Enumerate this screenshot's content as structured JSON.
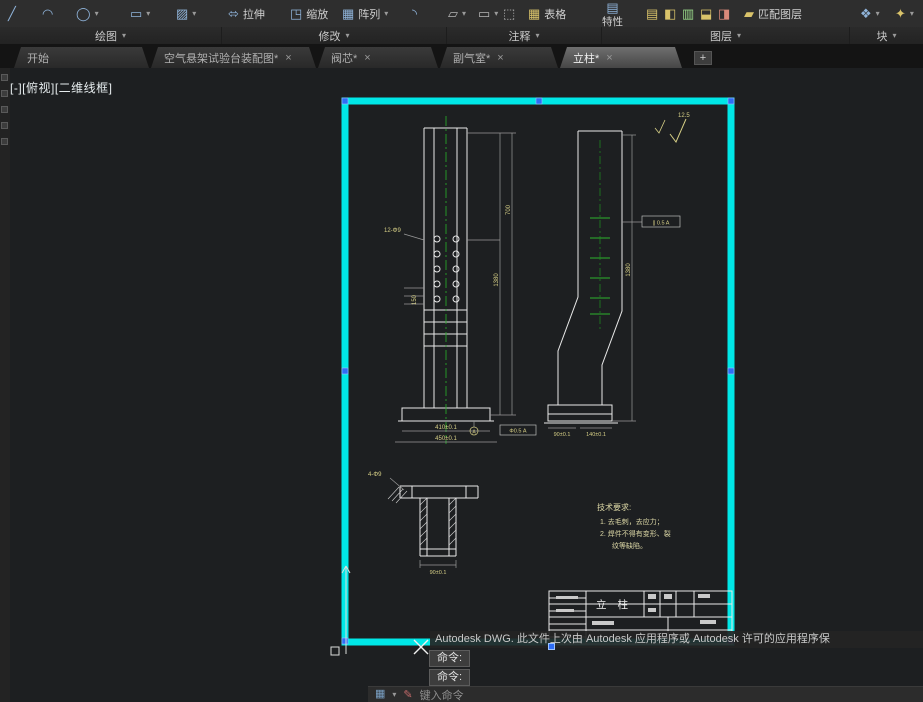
{
  "ribbon": {
    "row1": {
      "stretch": "拉伸",
      "scale": "缩放",
      "array": "阵列",
      "table": "表格",
      "properties": "特性",
      "match_layer": "匹配图层"
    },
    "panels": [
      {
        "label": "绘图"
      },
      {
        "label": "修改"
      },
      {
        "label": "注释"
      },
      {
        "label": "图层"
      },
      {
        "label": "块"
      }
    ]
  },
  "file_tabs": {
    "items": [
      {
        "label": "开始"
      },
      {
        "label": "空气悬架试验台装配图*"
      },
      {
        "label": "阀芯*"
      },
      {
        "label": "副气室*"
      },
      {
        "label": "立柱*"
      }
    ]
  },
  "viewport": {
    "controls_label": "[-][俯视][二维线框]"
  },
  "drawing": {
    "part_title": "立  柱",
    "tech_req": {
      "heading": "技术要求:",
      "item1": "1.  去毛刺，去应力；",
      "item2": "2.  焊件不得有变形、裂",
      "item2b": "纹等缺陷。"
    },
    "annotations": {
      "surface_finish": "12.5",
      "front_holes": "12-Φ9",
      "section_holes": "4-Φ9",
      "front_height": "1380",
      "front_height2": "700",
      "left_dim": "150",
      "front_base_dim1": "410±0.1",
      "front_base_dim2": "450±0.1",
      "side_height": "1380",
      "side_base_dim1": "90±0.1",
      "side_base_dim2": "140±0.1",
      "section_width": "90±0.1",
      "datum": "A",
      "tolerance_front": "Φ0.5 A",
      "tolerance_side": "∥ 0.5 A"
    }
  },
  "command": {
    "notice": "Autodesk DWG.  此文件上次由 Autodesk 应用程序或 Autodesk 许可的应用程序保",
    "prompt_line1": "命令:",
    "prompt_line2": "命令:",
    "input_placeholder": "键入命令"
  },
  "icons": {
    "dropdown": "▾",
    "close": "×",
    "new_tab": "+",
    "line": "╱",
    "arc": "◠",
    "circle": "◯",
    "rect": "▭",
    "hatch": "▨",
    "stretch": "⬄",
    "scale": "◳",
    "array": "▦",
    "fillet": "◝",
    "mini1": "▱",
    "mini2": "▭",
    "measure": "⬚",
    "table": "▦",
    "properties": "▤",
    "layer1": "▤",
    "layer2": "◧",
    "layer3": "▥",
    "layer4": "⬓",
    "layer5": "◨",
    "match": "▰",
    "block1": "❖",
    "block2": "✦",
    "grid": "▦",
    "pencil": "✎"
  },
  "colors": {
    "selection_frame": "#00e7e7",
    "grip": "#2e6df6",
    "centerline": "#27a327",
    "dim_text": "#d6cf86",
    "linework": "#e9e9e9"
  }
}
